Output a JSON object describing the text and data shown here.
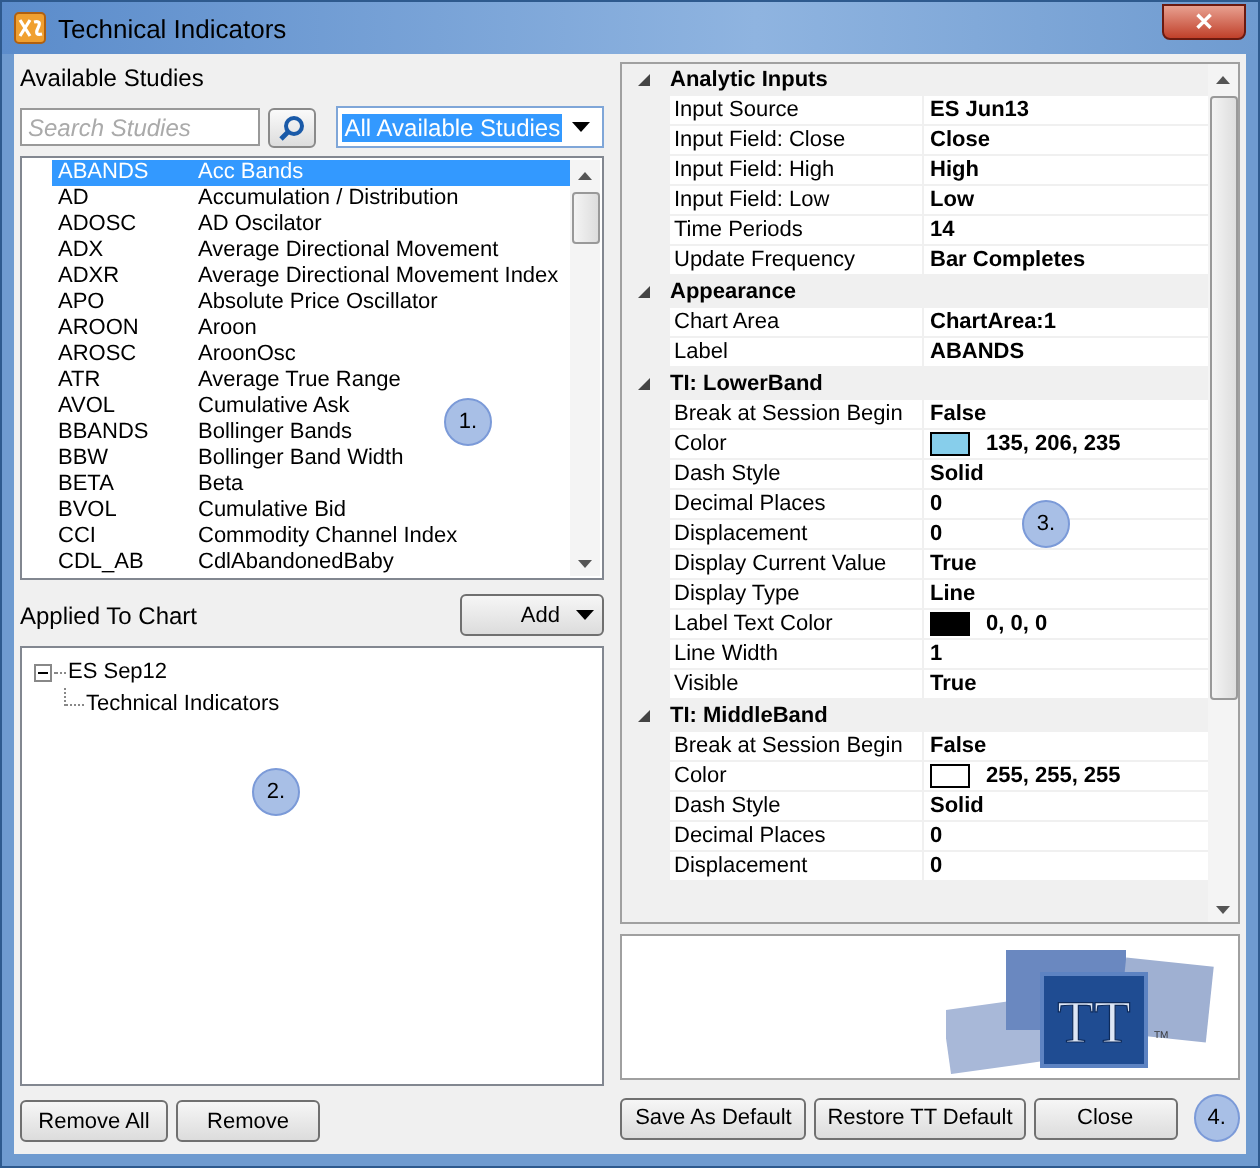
{
  "window": {
    "title": "Technical Indicators",
    "close": "✕"
  },
  "available": {
    "label": "Available Studies",
    "search": {
      "placeholder": "Search Studies"
    },
    "filter": {
      "value": "All Available Studies"
    },
    "studies": [
      {
        "code": "ABANDS",
        "name": "Acc Bands",
        "selected": true
      },
      {
        "code": "AD",
        "name": "Accumulation / Distribution",
        "selected": false
      },
      {
        "code": "ADOSC",
        "name": "AD Oscilator",
        "selected": false
      },
      {
        "code": "ADX",
        "name": "Average Directional Movement",
        "selected": false
      },
      {
        "code": "ADXR",
        "name": "Average Directional Movement Index",
        "selected": false
      },
      {
        "code": "APO",
        "name": "Absolute Price Oscillator",
        "selected": false
      },
      {
        "code": "AROON",
        "name": "Aroon",
        "selected": false
      },
      {
        "code": "AROSC",
        "name": "AroonOsc",
        "selected": false
      },
      {
        "code": "ATR",
        "name": "Average True Range",
        "selected": false
      },
      {
        "code": "AVOL",
        "name": "Cumulative Ask",
        "selected": false
      },
      {
        "code": "BBANDS",
        "name": "Bollinger Bands",
        "selected": false
      },
      {
        "code": "BBW",
        "name": "Bollinger Band Width",
        "selected": false
      },
      {
        "code": "BETA",
        "name": "Beta",
        "selected": false
      },
      {
        "code": "BVOL",
        "name": "Cumulative Bid",
        "selected": false
      },
      {
        "code": "CCI",
        "name": "Commodity Channel Index",
        "selected": false
      },
      {
        "code": "CDL_AB",
        "name": "CdlAbandonedBaby",
        "selected": false
      }
    ]
  },
  "applied": {
    "label": "Applied To Chart",
    "add_button": "Add",
    "tree": [
      {
        "label": "ES Sep12",
        "expanded": true,
        "children": [
          {
            "label": "Technical Indicators"
          }
        ]
      }
    ],
    "buttons": [
      "Remove All",
      "Remove"
    ]
  },
  "properties": [
    {
      "category": "Analytic Inputs",
      "expanded": true,
      "rows": [
        {
          "name": "Input Source",
          "value": "ES Jun13"
        },
        {
          "name": "Input Field: Close",
          "value": "Close"
        },
        {
          "name": "Input Field: High",
          "value": "High"
        },
        {
          "name": "Input Field: Low",
          "value": "Low"
        },
        {
          "name": "Time Periods",
          "value": "14"
        },
        {
          "name": "Update Frequency",
          "value": "Bar Completes"
        }
      ]
    },
    {
      "category": "Appearance",
      "expanded": true,
      "rows": [
        {
          "name": "Chart Area",
          "value": "ChartArea:1"
        },
        {
          "name": "Label",
          "value": "ABANDS"
        }
      ]
    },
    {
      "category": "TI: LowerBand",
      "expanded": true,
      "rows": [
        {
          "name": "Break at Session Begin",
          "value": "False"
        },
        {
          "name": "Color",
          "value": "135, 206, 235",
          "color": "#87ceeb"
        },
        {
          "name": "Dash Style",
          "value": "Solid"
        },
        {
          "name": "Decimal Places",
          "value": "0"
        },
        {
          "name": "Displacement",
          "value": "0"
        },
        {
          "name": "Display Current Value",
          "value": "True"
        },
        {
          "name": "Display Type",
          "value": "Line"
        },
        {
          "name": "Label Text Color",
          "value": "0, 0, 0",
          "color": "#000000"
        },
        {
          "name": "Line Width",
          "value": "1"
        },
        {
          "name": "Visible",
          "value": "True"
        }
      ]
    },
    {
      "category": "TI: MiddleBand",
      "expanded": true,
      "rows": [
        {
          "name": "Break at Session Begin",
          "value": "False"
        },
        {
          "name": "Color",
          "value": "255, 255, 255",
          "color": "#ffffff"
        },
        {
          "name": "Dash Style",
          "value": "Solid"
        },
        {
          "name": "Decimal Places",
          "value": "0"
        },
        {
          "name": "Displacement",
          "value": "0"
        }
      ]
    }
  ],
  "logo": {
    "mark": "TT",
    "tm": "TM"
  },
  "buttons": [
    "Save As Default",
    "Restore TT Default",
    "Close"
  ],
  "callouts": [
    "1.",
    "2.",
    "3.",
    "4."
  ]
}
